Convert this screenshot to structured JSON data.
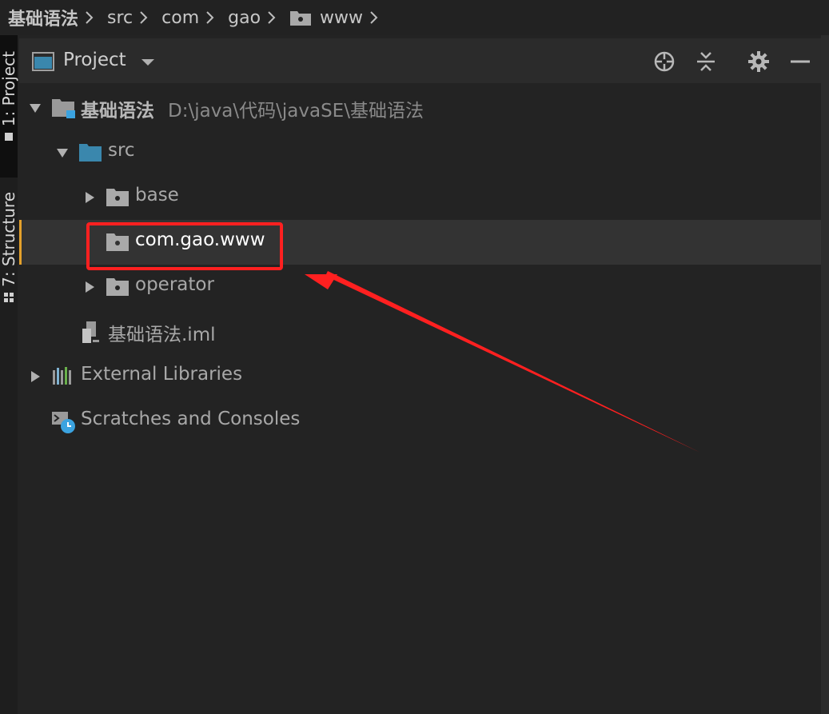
{
  "breadcrumb": {
    "items": [
      "基础语法",
      "src",
      "com",
      "gao",
      "www"
    ]
  },
  "left_stripe": {
    "project_tab": "1: Project",
    "structure_tab": "7: Structure"
  },
  "panel": {
    "title": "Project"
  },
  "tree": {
    "root": {
      "name": "基础语法",
      "path": "D:\\java\\代码\\javaSE\\基础语法"
    },
    "src": "src",
    "base": "base",
    "selected_package": "com.gao.www",
    "operator": "operator",
    "iml_file": "基础语法.iml",
    "external_libraries": "External Libraries",
    "scratches": "Scratches and Consoles"
  },
  "colors": {
    "background": "#232323",
    "header": "#2b2b2b",
    "selection": "#333333",
    "selection_accent": "#e3a02b",
    "folder_blue": "#3a87ad",
    "annotation_red": "#ff2020"
  },
  "icons": {
    "project_icon": "project-window-icon",
    "locate": "crosshair-icon",
    "collapse": "collapse-all-icon",
    "settings": "gear-icon",
    "hide": "minimize-icon"
  }
}
